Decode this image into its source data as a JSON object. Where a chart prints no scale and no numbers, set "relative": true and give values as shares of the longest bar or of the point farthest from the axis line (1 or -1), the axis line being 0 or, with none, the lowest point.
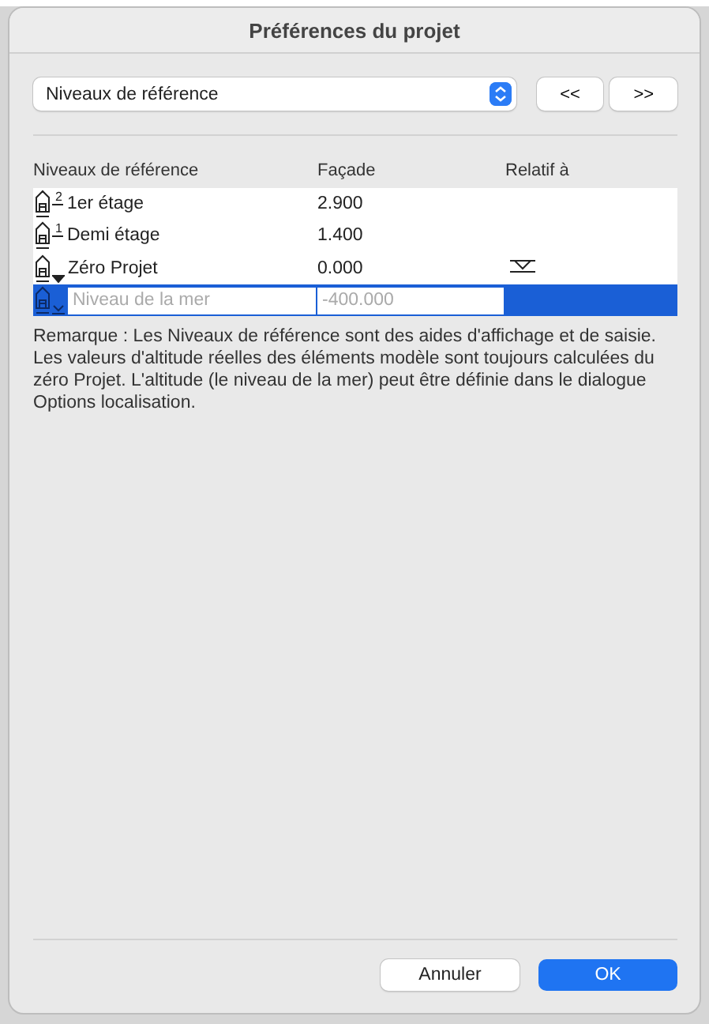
{
  "window": {
    "title": "Préférences du projet"
  },
  "category_popup": {
    "value": "Niveaux de référence"
  },
  "nav_buttons": [
    "<<",
    ">>"
  ],
  "table": {
    "columns": [
      "Niveaux de référence",
      "Façade",
      "Relatif à"
    ],
    "rows": [
      {
        "kind": "numbered",
        "badge": "2",
        "name": "1er étage",
        "elevation": "2.900",
        "relative": false,
        "selected": false
      },
      {
        "kind": "numbered",
        "badge": "1",
        "name": "Demi étage",
        "elevation": "1.400",
        "relative": false,
        "selected": false
      },
      {
        "kind": "zero",
        "name": "Zéro Projet",
        "elevation": "0.000",
        "relative": true,
        "selected": false
      },
      {
        "kind": "sea",
        "name_placeholder": "Niveau de la mer",
        "elevation_placeholder": "-400.000",
        "relative": false,
        "selected": true
      }
    ]
  },
  "note": "Remarque : Les Niveaux de référence sont des aides d'affichage et de saisie. Les valeurs d'altitude réelles des éléments modèle sont toujours calculées du zéro Projet. L'altitude (le niveau de la mer) peut être définie dans le dialogue Options localisation.",
  "buttons": [
    {
      "label": "Annuler",
      "kind": "secondary"
    },
    {
      "label": "OK",
      "kind": "primary"
    }
  ]
}
